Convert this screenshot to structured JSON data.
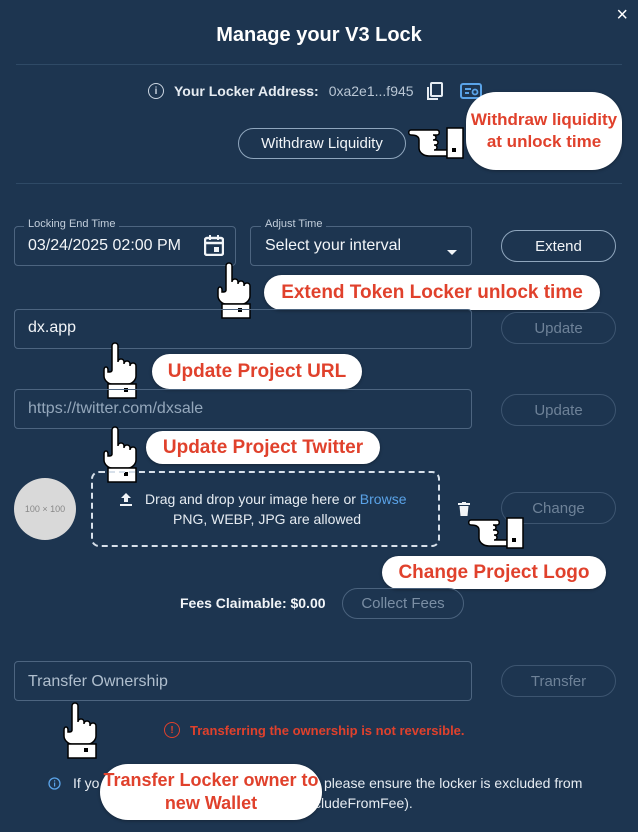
{
  "modal": {
    "title": "Manage your V3 Lock",
    "close": "×"
  },
  "locker": {
    "address_label": "Your Locker Address:",
    "address_value": "0xa2e1...f945",
    "withdraw_button": "Withdraw Liquidity"
  },
  "lock_time": {
    "end_label": "Locking End Time",
    "end_value": "03/24/2025 02:00 PM",
    "adjust_label": "Adjust Time",
    "adjust_value": "Select your interval",
    "extend_button": "Extend"
  },
  "project_url": {
    "value": "dx.app",
    "update_button": "Update"
  },
  "project_twitter": {
    "placeholder": "https://twitter.com/dxsale",
    "update_button": "Update"
  },
  "logo": {
    "avatar_text": "100 × 100",
    "drop_text": "Drag and drop your image here or",
    "browse_link": "Browse",
    "formats_text": "PNG, WEBP, JPG are allowed",
    "change_button": "Change"
  },
  "fees": {
    "label": "Fees Claimable: $0.00",
    "collect_button": "Collect Fees"
  },
  "transfer": {
    "placeholder": "Transfer Ownership",
    "transfer_button": "Transfer",
    "warning": "Transferring the ownership is not reversible.",
    "note_start": "If yo",
    "note_end": "please ensure the locker is excluded from",
    "note_line2": "cludeFromFee)."
  },
  "callouts": {
    "withdraw": "Withdraw liquidity at unlock time",
    "extend": "Extend Token Locker unlock time",
    "url": "Update Project URL",
    "twitter": "Update Project Twitter",
    "logo": "Change Project Logo",
    "transfer": "Transfer Locker owner to new Wallet"
  },
  "colors": {
    "background": "#1d3550",
    "callout_text": "#e0412c",
    "warning": "#e0412c",
    "link": "#5aa3e8"
  }
}
